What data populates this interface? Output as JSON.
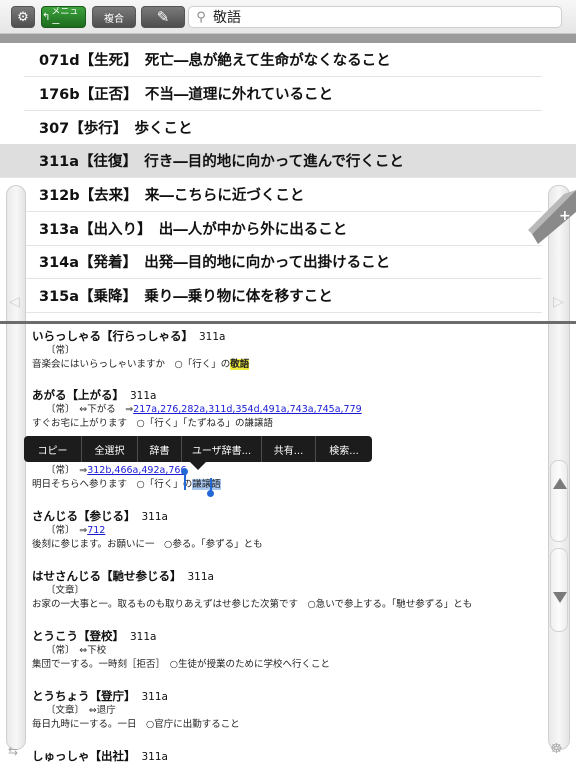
{
  "toolbar": {
    "gear_icon": "⚙",
    "menu_label": "メニュー",
    "fukugo_label": "複合",
    "pen_icon": "✎",
    "search_value": "敬語"
  },
  "upper_list": [
    {
      "text": "071d【生死】　死亡―息が絶えて生命がなくなること",
      "selected": false
    },
    {
      "text": "176b【正否】　不当―道理に外れていること",
      "selected": false
    },
    {
      "text": "307【歩行】　歩くこと",
      "selected": false
    },
    {
      "text": "311a【往復】　行き―目的地に向かって進んで行くこと",
      "selected": true
    },
    {
      "text": "312b【去来】　来―こちらに近づくこと",
      "selected": false
    },
    {
      "text": "313a【出入り】　出―人が中から外に出ること",
      "selected": false
    },
    {
      "text": "314a【発着】　出発―目的地に向かって出掛けること",
      "selected": false
    },
    {
      "text": "315a【乗降】　乗り―乗り物に体を移すこと",
      "selected": false
    }
  ],
  "entries": {
    "e1": {
      "head": "いらっしゃる【行らっしゃる】",
      "code": "311a",
      "l1": "〔常〕",
      "l2a": "音楽会にはいらっしゃいますか　○「行く」の",
      "l2b": "敬語"
    },
    "e2": {
      "head": "あがる【上がる】",
      "code": "311a",
      "l1a": "〔常〕　⇔下がる　⇒",
      "l1b": "217a,276,282a,311d,354d,491a,743a,745a,779",
      "l2": "すぐお宅に上がります　○「行く」「たずねる」の謙譲語"
    },
    "e3": {
      "l1a": "〔常〕　⇒",
      "l1b": "312b,466a,492a,766",
      "l2a": "明日そちらへ参ります　○「行く」の",
      "l2b": "謙譲語"
    },
    "e4": {
      "head": "さんじる【参じる】",
      "code": "311a",
      "l1a": "〔常〕　⇒",
      "l1b": "712",
      "l2": "後刻に参じます。お願いに一　○参る。「参ずる」とも"
    },
    "e5": {
      "head": "はせさんじる【馳せ参じる】",
      "code": "311a",
      "l1": "〔文章〕",
      "l2": "お家の一大事と一。取るものも取りあえずはせ参じた次第です　○急いで参上する。「馳せ参ずる」とも"
    },
    "e6": {
      "head": "とうこう【登校】",
      "code": "311a",
      "l1": "〔常〕　⇔下校",
      "l2": "集団で一する。一時刻［拒否］　○生徒が授業のために学校へ行くこと"
    },
    "e7": {
      "head": "とうちょう【登庁】",
      "code": "311a",
      "l1": "〔文章〕　⇔退庁",
      "l2": "毎日九時に一する。一日　○官庁に出勤すること"
    },
    "e8": {
      "head": "しゅっしゃ【出社】",
      "code": "311a"
    }
  },
  "context_menu": [
    "コピー",
    "全選択",
    "辞書",
    "ユーザ辞書...",
    "共有...",
    "検索..."
  ]
}
